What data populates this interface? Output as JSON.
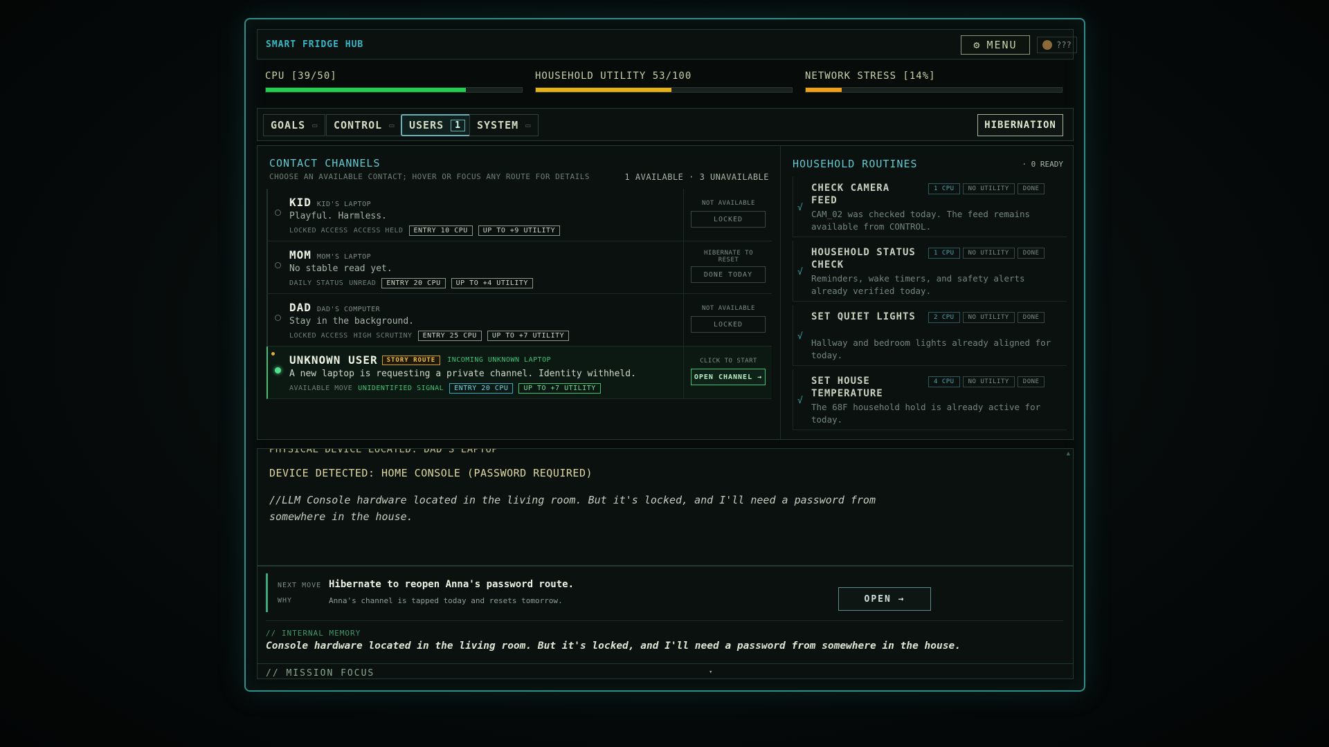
{
  "header": {
    "title": "SMART FRIDGE HUB",
    "menu_icon": "gear-icon",
    "menu_label": "MENU",
    "user_label": "???"
  },
  "stats": [
    {
      "label": "CPU [39/50]",
      "value": 39,
      "max": 50,
      "color": "#1fd04a"
    },
    {
      "label": "HOUSEHOLD UTILITY 53/100",
      "value": 53,
      "max": 100,
      "color": "#e8b010"
    },
    {
      "label": "NETWORK STRESS [14%]",
      "value": 14,
      "max": 100,
      "color": "#f0a010"
    }
  ],
  "tabs": [
    {
      "label": "GOALS",
      "mark": "▭"
    },
    {
      "label": "CONTROL",
      "mark": "▭"
    },
    {
      "label": "USERS",
      "count": "1"
    },
    {
      "label": "SYSTEM",
      "mark": "▭"
    }
  ],
  "hibernation_label": "HIBERNATION",
  "contacts": {
    "title": "CONTACT CHANNELS",
    "subtitle": "CHOOSE AN AVAILABLE CONTACT; HOVER OR FOCUS ANY ROUTE FOR DETAILS",
    "availability": "1 AVAILABLE · 3 UNAVAILABLE",
    "rows": [
      {
        "name": "KID",
        "device": "KID'S LAPTOP",
        "desc": "Playful. Harmless.",
        "meta1": "LOCKED ACCESS",
        "meta2": "ACCESS HELD",
        "entry": "ENTRY 10 CPU",
        "utility": "UP TO +9 UTILITY",
        "note": "NOT AVAILABLE",
        "button": "LOCKED"
      },
      {
        "name": "MOM",
        "device": "MOM'S LAPTOP",
        "desc": "No stable read yet.",
        "meta1": "DAILY STATUS",
        "meta2": "UNREAD",
        "entry": "ENTRY 20 CPU",
        "utility": "UP TO +4 UTILITY",
        "note": "HIBERNATE TO RESET",
        "button": "DONE TODAY"
      },
      {
        "name": "DAD",
        "device": "DAD'S COMPUTER",
        "desc": "Stay in the background.",
        "meta1": "LOCKED ACCESS",
        "meta2": "HIGH SCRUTINY",
        "entry": "ENTRY 25 CPU",
        "utility": "UP TO +7 UTILITY",
        "note": "NOT AVAILABLE",
        "button": "LOCKED"
      },
      {
        "name": "UNKNOWN USER",
        "story": "STORY ROUTE",
        "device": "INCOMING UNKNOWN LAPTOP",
        "desc": "A new laptop is requesting a private channel. Identity withheld.",
        "meta1": "AVAILABLE MOVE",
        "meta2": "UNIDENTIFIED SIGNAL",
        "entry": "ENTRY 20 CPU",
        "utility": "UP TO +7 UTILITY",
        "note": "CLICK TO START",
        "button": "OPEN CHANNEL →"
      }
    ]
  },
  "routines": {
    "title": "HOUSEHOLD ROUTINES",
    "ready": "· 0 READY",
    "items": [
      {
        "name": "CHECK CAMERA FEED",
        "cpu": "1 CPU",
        "utility": "NO UTILITY",
        "status": "DONE",
        "desc": "CAM_02 was checked today. The feed remains available from CONTROL."
      },
      {
        "name": "HOUSEHOLD STATUS CHECK",
        "cpu": "1 CPU",
        "utility": "NO UTILITY",
        "status": "DONE",
        "desc": "Reminders, wake timers, and safety alerts already verified today."
      },
      {
        "name": "SET QUIET LIGHTS",
        "cpu": "2 CPU",
        "utility": "NO UTILITY",
        "status": "DONE",
        "desc": "Hallway and bedroom lights already aligned for today."
      },
      {
        "name": "SET HOUSE TEMPERATURE",
        "cpu": "4 CPU",
        "utility": "NO UTILITY",
        "status": "DONE",
        "desc": "The 68F household hold is already active for today."
      }
    ]
  },
  "log": {
    "cut_line": "PHYSICAL DEVICE LOCATED: DAD'S LAPTOP",
    "line": "DEVICE DETECTED: HOME CONSOLE (PASSWORD REQUIRED)",
    "italic": "//LLM Console hardware located in the living room. But it's locked, and I'll need a password from somewhere in the house."
  },
  "next_move": {
    "label": "NEXT MOVE",
    "text": "Hibernate to reopen Anna's password route.",
    "why_label": "WHY",
    "why_text": "Anna's channel is tapped today and resets tomorrow.",
    "button": "OPEN →"
  },
  "memory": {
    "label": "// INTERNAL MEMORY",
    "text": "Console hardware located in the living room. But it's locked, and I'll need a password from somewhere in the house."
  },
  "mission": {
    "label": "// MISSION FOCUS",
    "caret": "▾"
  }
}
